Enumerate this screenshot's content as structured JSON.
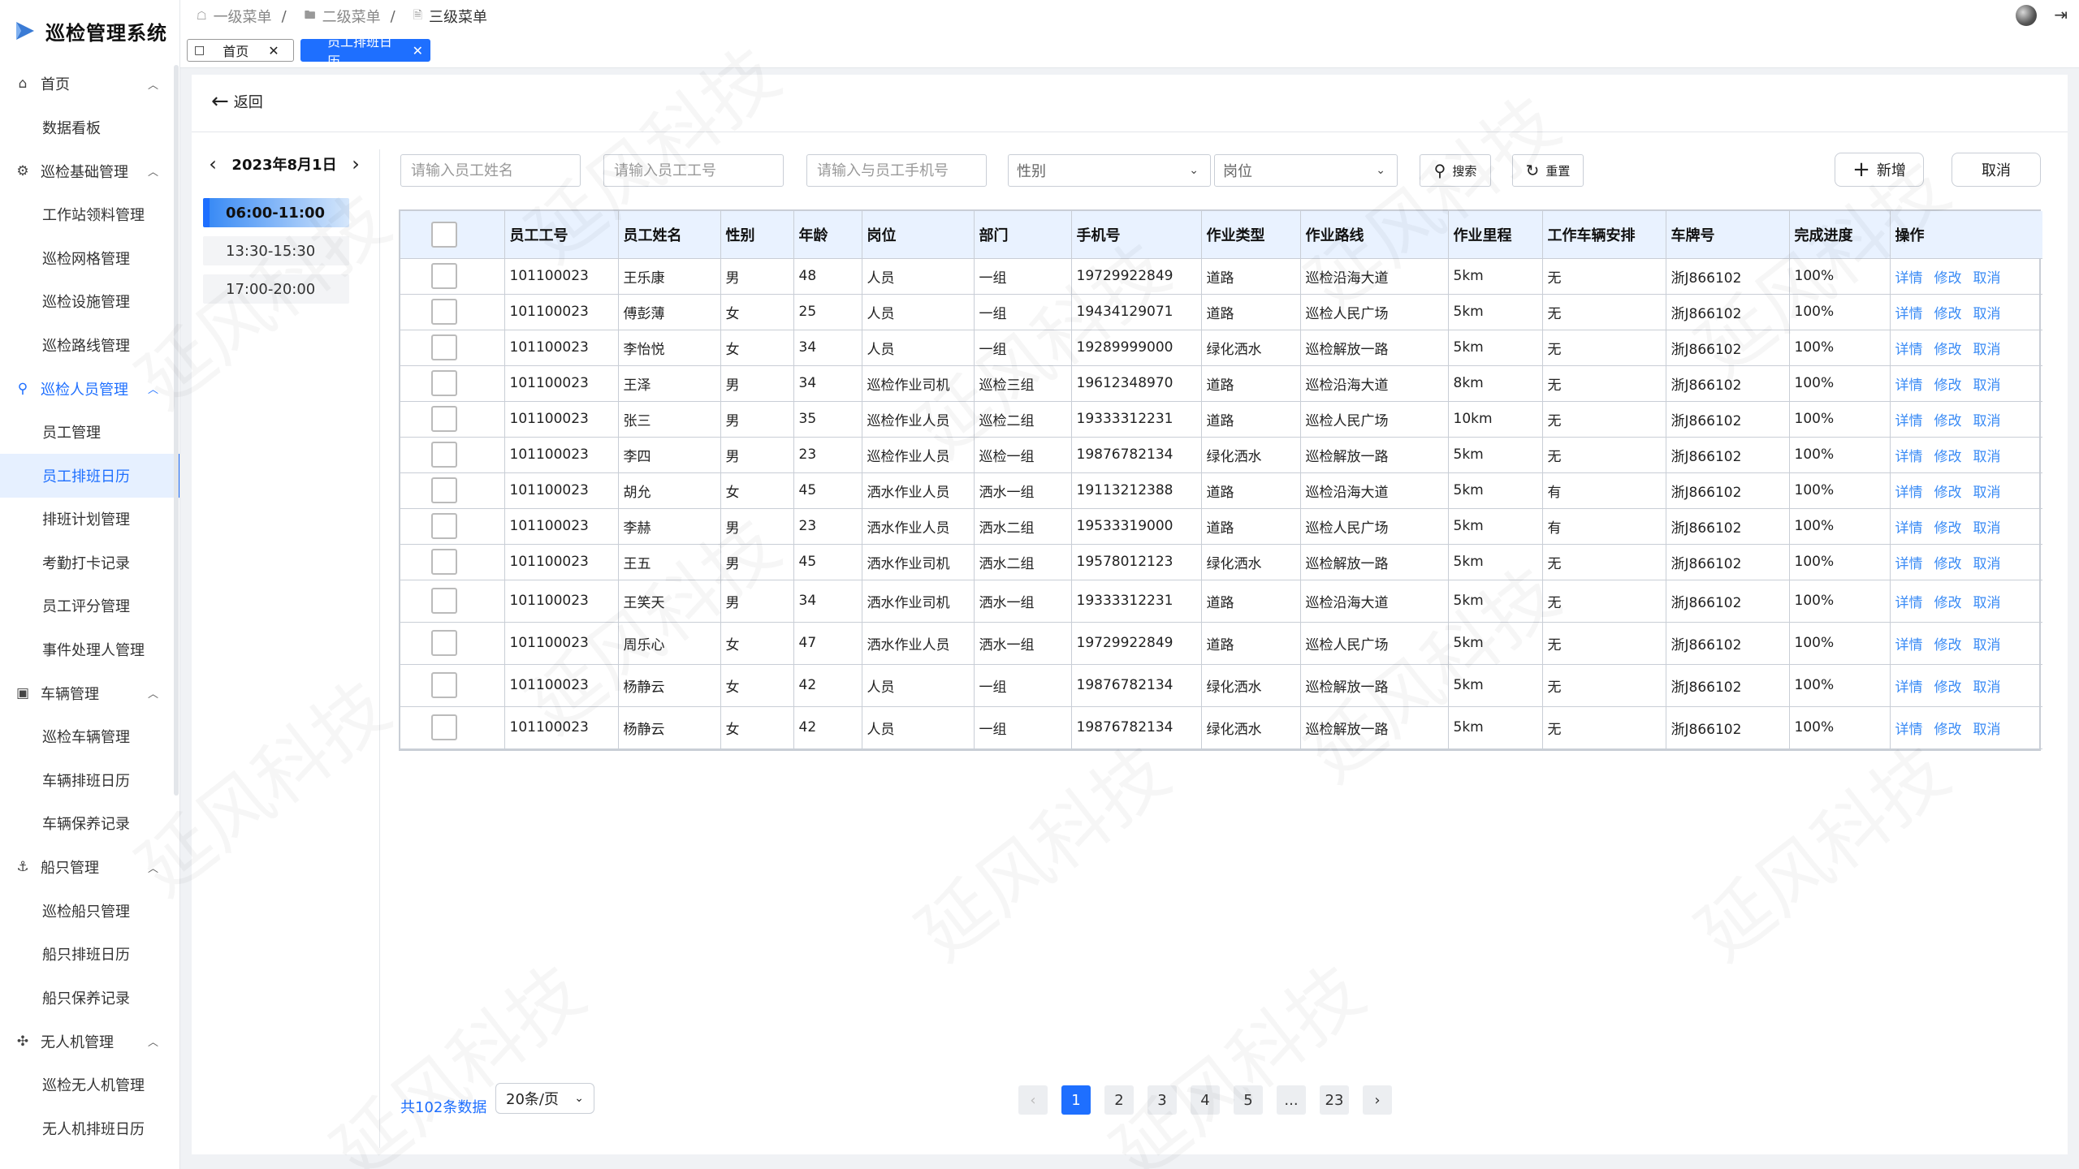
{
  "app": {
    "title": "巡检管理系统"
  },
  "sidebar": {
    "groups": [
      {
        "label": "首页",
        "icon": "home-icon",
        "active": false,
        "items": [
          {
            "label": "数据看板"
          }
        ]
      },
      {
        "label": "巡检基础管理",
        "icon": "settings-icon",
        "active": false,
        "items": [
          {
            "label": "工作站领料管理"
          },
          {
            "label": "巡检网格管理"
          },
          {
            "label": "巡检设施管理"
          },
          {
            "label": "巡检路线管理"
          }
        ]
      },
      {
        "label": "巡检人员管理",
        "icon": "person-running-icon",
        "active": true,
        "items": [
          {
            "label": "员工管理"
          },
          {
            "label": "员工排班日历"
          },
          {
            "label": "排班计划管理"
          },
          {
            "label": "考勤打卡记录"
          },
          {
            "label": "员工评分管理"
          },
          {
            "label": "事件处理人管理"
          }
        ]
      },
      {
        "label": "车辆管理",
        "icon": "car-icon",
        "active": false,
        "items": [
          {
            "label": "巡检车辆管理"
          },
          {
            "label": "车辆排班日历"
          },
          {
            "label": "车辆保养记录"
          }
        ]
      },
      {
        "label": "船只管理",
        "icon": "ship-icon",
        "active": false,
        "items": [
          {
            "label": "巡检船只管理"
          },
          {
            "label": "船只排班日历"
          },
          {
            "label": "船只保养记录"
          }
        ]
      },
      {
        "label": "无人机管理",
        "icon": "drone-icon",
        "active": false,
        "items": [
          {
            "label": "巡检无人机管理"
          },
          {
            "label": "无人机排班日历"
          }
        ]
      }
    ]
  },
  "breadcrumb": [
    {
      "label": "一级菜单",
      "icon": "home-icon"
    },
    {
      "label": "二级菜单",
      "icon": "folder-icon"
    },
    {
      "label": "三级菜单",
      "icon": "document-icon"
    }
  ],
  "tabs": [
    {
      "label": "首页"
    },
    {
      "label": "员工排班日历"
    }
  ],
  "page": {
    "back_label": "返回"
  },
  "calendar": {
    "date": "2023年8月1日",
    "slots": [
      "06:00-11:00",
      "13:30-15:30",
      "17:00-20:00"
    ]
  },
  "filters": {
    "name_placeholder": "请输入员工姓名",
    "id_placeholder": "请输入员工工号",
    "phone_placeholder": "请输入与员工手机号",
    "gender_placeholder": "性别",
    "position_placeholder": "岗位",
    "search_label": "搜索",
    "reset_label": "重置",
    "add_label": "新增",
    "cancel_label": "取消"
  },
  "table": {
    "headers": [
      "员工工号",
      "员工姓名",
      "性别",
      "年龄",
      "岗位",
      "部门",
      "手机号",
      "作业类型",
      "作业路线",
      "作业里程",
      "工作车辆安排",
      "车牌号",
      "完成进度",
      "操作"
    ],
    "actions": [
      "详情",
      "修改",
      "取消"
    ],
    "rows": [
      [
        "101100023",
        "王乐康",
        "男",
        "48",
        "人员",
        "一组",
        "19729922849",
        "道路",
        "巡检沿海大道",
        "5km",
        "无",
        "浙J866102",
        "100%"
      ],
      [
        "101100023",
        "傅彭薄",
        "女",
        "25",
        "人员",
        "一组",
        "19434129071",
        "道路",
        "巡检人民广场",
        "5km",
        "无",
        "浙J866102",
        "100%"
      ],
      [
        "101100023",
        "李怡悦",
        "女",
        "34",
        "人员",
        "一组",
        "19289999000",
        "绿化洒水",
        "巡检解放一路",
        "5km",
        "无",
        "浙J866102",
        "100%"
      ],
      [
        "101100023",
        "王泽",
        "男",
        "34",
        "巡检作业司机",
        "巡检三组",
        "19612348970",
        "道路",
        "巡检沿海大道",
        "8km",
        "无",
        "浙J866102",
        "100%"
      ],
      [
        "101100023",
        "张三",
        "男",
        "35",
        "巡检作业人员",
        "巡检二组",
        "19333312231",
        "道路",
        "巡检人民广场",
        "10km",
        "无",
        "浙J866102",
        "100%"
      ],
      [
        "101100023",
        "李四",
        "男",
        "23",
        "巡检作业人员",
        "巡检一组",
        "19876782134",
        "绿化洒水",
        "巡检解放一路",
        "5km",
        "无",
        "浙J866102",
        "100%"
      ],
      [
        "101100023",
        "胡允",
        "女",
        "45",
        "洒水作业人员",
        "洒水一组",
        "19113212388",
        "道路",
        "巡检沿海大道",
        "5km",
        "有",
        "浙J866102",
        "100%"
      ],
      [
        "101100023",
        "李赫",
        "男",
        "23",
        "洒水作业人员",
        "洒水二组",
        "19533319000",
        "道路",
        "巡检人民广场",
        "5km",
        "有",
        "浙J866102",
        "100%"
      ],
      [
        "101100023",
        "王五",
        "男",
        "45",
        "洒水作业司机",
        "洒水二组",
        "19578012123",
        "绿化洒水",
        "巡检解放一路",
        "5km",
        "无",
        "浙J866102",
        "100%"
      ],
      [
        "101100023",
        "王笑天",
        "男",
        "34",
        "洒水作业司机",
        "洒水一组",
        "19333312231",
        "道路",
        "巡检沿海大道",
        "5km",
        "无",
        "浙J866102",
        "100%"
      ],
      [
        "101100023",
        "周乐心",
        "女",
        "47",
        "洒水作业人员",
        "洒水一组",
        "19729922849",
        "道路",
        "巡检人民广场",
        "5km",
        "无",
        "浙J866102",
        "100%"
      ],
      [
        "101100023",
        "杨静云",
        "女",
        "42",
        "人员",
        "一组",
        "19876782134",
        "绿化洒水",
        "巡检解放一路",
        "5km",
        "无",
        "浙J866102",
        "100%"
      ],
      [
        "101100023",
        "杨静云",
        "女",
        "42",
        "人员",
        "一组",
        "19876782134",
        "绿化洒水",
        "巡检解放一路",
        "5km",
        "无",
        "浙J866102",
        "100%"
      ]
    ]
  },
  "footer": {
    "total_text": "共102条数据",
    "page_size": "20条/页",
    "pages": [
      "1",
      "2",
      "3",
      "4",
      "5",
      "...",
      "23"
    ],
    "current_page": "1"
  },
  "watermark": "延风科技",
  "colors": {
    "accent": "#1e6fff",
    "header_bg": "#e9f2ff",
    "link": "#3a8bf5"
  }
}
